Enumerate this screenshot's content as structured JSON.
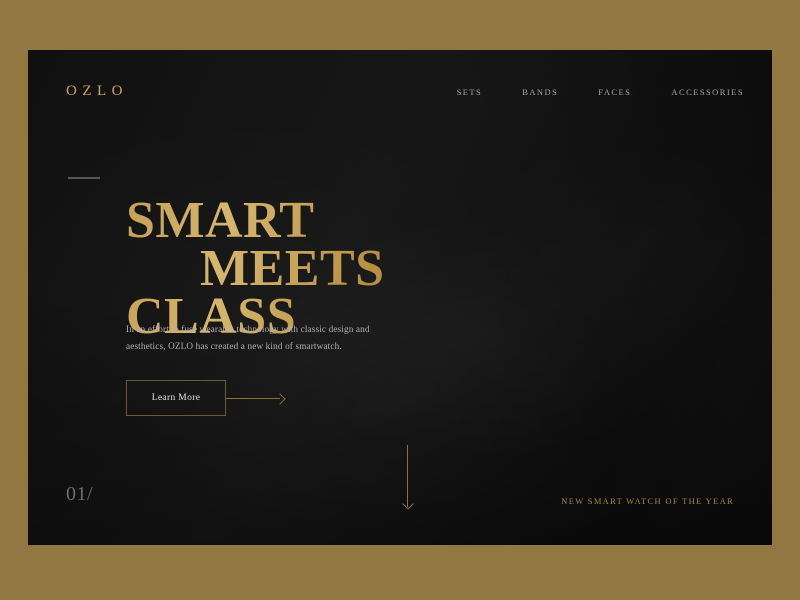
{
  "page": {
    "background_color": "#917843",
    "panel_color": "#121212",
    "accent_gold": "#c09441",
    "muted_text": "#a9a9a9"
  },
  "header": {
    "logo": "OZLO",
    "nav": [
      {
        "label": "SETS"
      },
      {
        "label": "BANDS"
      },
      {
        "label": "FACES"
      },
      {
        "label": "ACCESSORIES"
      }
    ]
  },
  "hero": {
    "headline_line_1": "SMART",
    "headline_line_2": "MEETS",
    "headline_line_3": "CLASS",
    "body": "In an effort to fuse wearable technology with classic design and aesthetics, OZLO has created a new kind of smartwatch.",
    "cta_label": "Learn More"
  },
  "footer": {
    "slide_number": "01/",
    "tagline": "NEW SMART WATCH OF THE YEAR"
  }
}
